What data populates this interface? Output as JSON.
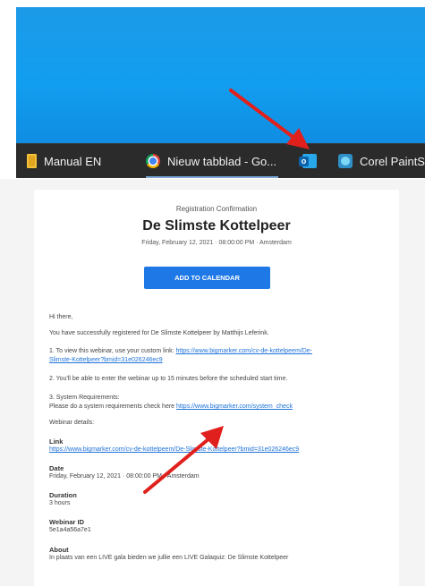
{
  "taskbar": {
    "items": [
      {
        "label": "Manual EN",
        "icon": "folder-icon"
      },
      {
        "label": "Nieuw tabblad - Go...",
        "icon": "chrome-icon"
      },
      {
        "label": "",
        "icon": "outlook-icon"
      },
      {
        "label": "Corel PaintSh",
        "icon": "corel-paintshop-icon"
      }
    ]
  },
  "annotation_color": "#e0201c",
  "email": {
    "registration": "Registration Confirmation",
    "title": "De Slimste Kottelpeer",
    "datetime": "Friday, February 12, 2021 · 08:00:00 PM · Amsterdam",
    "calendar_button": "ADD TO CALENDAR",
    "greeting": "Hi there,",
    "registered": "You have successfully registered for De Slimste Kottelpeer by Matthijs Leferink.",
    "step1_text": "1. To view this webinar, use your custom link: ",
    "step1_link_a": "https://www.bigmarker.com/cv-de-kottelpeem/De-",
    "step1_link_b": "Slimste-Kottelpeer?bmid=31e026246ec9",
    "step2": "2. You'll be able to enter the webinar up to 15 minutes before the scheduled start time.",
    "step3_title": "3. System Requirements:",
    "step3_text": "Please do a system requirements check here ",
    "step3_link": "https://www.bigmarker.com/system_check",
    "details": "Webinar details:",
    "link_label": "Link",
    "link_value": "https://www.bigmarker.com/cv-de-kottelpeem/De-Slimste-Kottelpeer?bmid=31e026246ec9",
    "date_label": "Date",
    "date_value": "Friday, February 12, 2021 · 08:00:00 PM · Amsterdam",
    "duration_label": "Duration",
    "duration_value": "3 hours",
    "id_label": "Webinar ID",
    "id_value": "5e1a4a56a7e1",
    "about_label": "About",
    "about_value": "In plaats van een LIVE gala bieden we jullie een LIVE Galaquiz: De Slimste Kottelpeer"
  }
}
